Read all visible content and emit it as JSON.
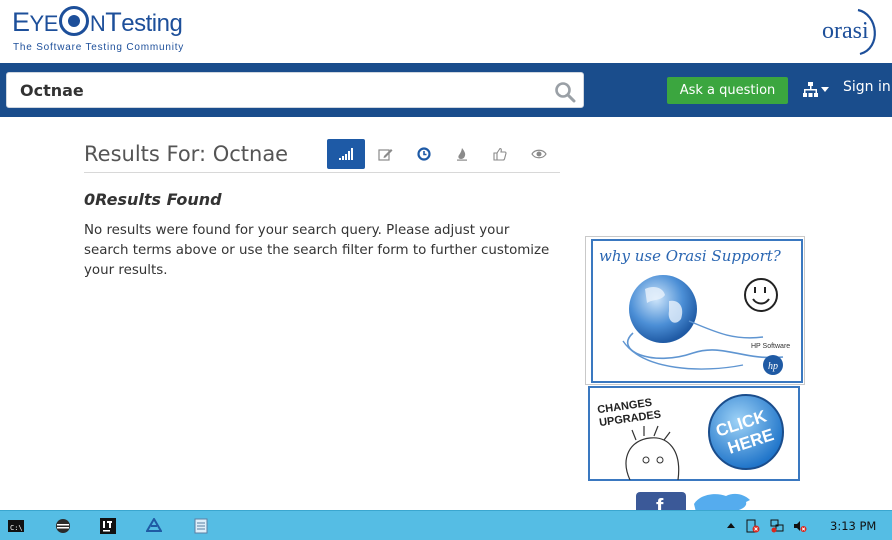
{
  "header": {
    "logo_text": "EyeOnTesting",
    "logo_tagline": "The Software Testing Community",
    "partner_logo": "orasi"
  },
  "navbar": {
    "search_value": "Octnae",
    "search_placeholder": "",
    "ask_button": "Ask a question",
    "signin": "Sign in"
  },
  "results": {
    "title": "Results For: Octnae",
    "found": "0Results Found",
    "message": "No results were found for your search query. Please adjust your search terms above or use the search filter form to further customize your results.",
    "filter_tabs": [
      {
        "icon": "signal-bars-icon",
        "active": true
      },
      {
        "icon": "edit-icon",
        "active": false
      },
      {
        "icon": "clock-icon",
        "active": false
      },
      {
        "icon": "flame-icon",
        "active": false
      },
      {
        "icon": "thumbs-up-icon",
        "active": false
      },
      {
        "icon": "eye-icon",
        "active": false
      }
    ]
  },
  "ads": {
    "ad1_text": "why use Orasi Support?",
    "ad1_sub": "HP Software",
    "ad2_text": "CHANGES UPGRADES",
    "ad2_button": "CLICK HERE"
  },
  "taskbar": {
    "time": "3:13 PM",
    "apps": [
      "cmd-icon",
      "browser-icon",
      "intellij-icon",
      "drive-icon",
      "notepad-icon"
    ]
  },
  "colors": {
    "navbar": "#1a4d8c",
    "brand": "#1d4f9a",
    "ask_button": "#3ba63f",
    "active_tab": "#1e5aa6",
    "taskbar": "#55bde4"
  }
}
